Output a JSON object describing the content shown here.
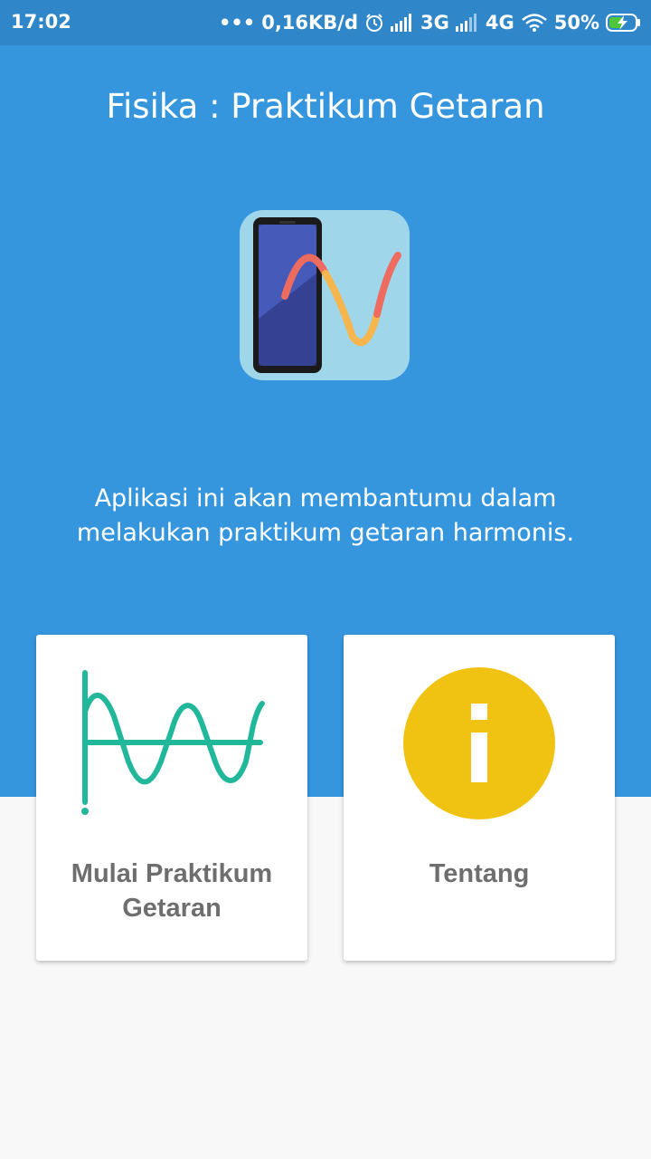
{
  "status_bar": {
    "time": "17:02",
    "dots": "•••",
    "net_speed": "0,16KB/d",
    "net_3g": "3G",
    "net_4g": "4G",
    "battery": "50%"
  },
  "header": {
    "title": "Fisika : Praktikum Getaran"
  },
  "description": {
    "line1": "Aplikasi ini akan membantumu dalam",
    "line2": "melakukan praktikum getaran harmonis."
  },
  "cards": [
    {
      "label": "Mulai Praktikum Getaran",
      "icon": "sine-wave-icon"
    },
    {
      "label": "Tentang",
      "icon": "info-icon"
    }
  ],
  "colors": {
    "primary": "#3696dd",
    "status_bar": "#2f86c8",
    "wave_teal": "#20b79a",
    "info_yellow": "#f0c312",
    "label_gray": "#6e6e6e"
  }
}
